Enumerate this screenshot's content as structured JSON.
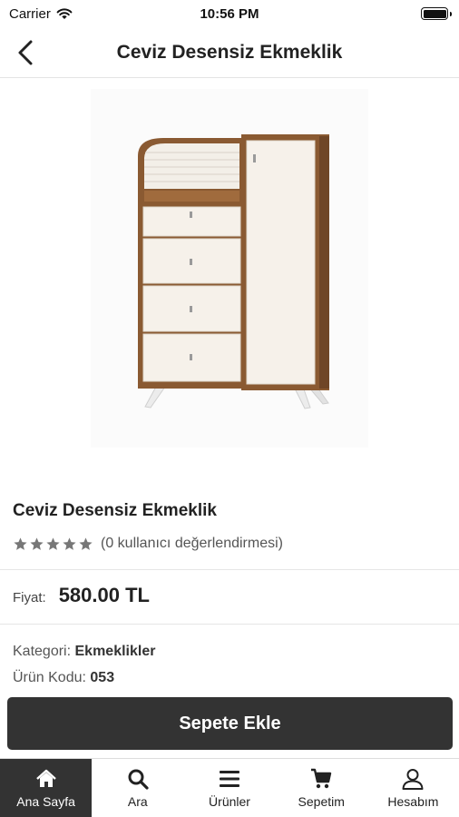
{
  "status": {
    "carrier": "Carrier",
    "time": "10:56 PM"
  },
  "nav": {
    "title": "Ceviz Desensiz Ekmeklik"
  },
  "product": {
    "name": "Ceviz Desensiz Ekmeklik",
    "rating_text": "(0 kullanıcı değerlendirmesi)",
    "rating_value": 0,
    "rating_max": 5,
    "price_label": "Fiyat:",
    "price": "580.00 TL",
    "category_label": "Kategori:",
    "category": "Ekmeklikler",
    "code_label": "Ürün Kodu:",
    "code": "053"
  },
  "actions": {
    "add_to_cart": "Sepete Ekle"
  },
  "tabs": [
    {
      "label": "Ana Sayfa",
      "icon": "home-icon",
      "active": true
    },
    {
      "label": "Ara",
      "icon": "search-icon",
      "active": false
    },
    {
      "label": "Ürünler",
      "icon": "menu-icon",
      "active": false
    },
    {
      "label": "Sepetim",
      "icon": "cart-icon",
      "active": false
    },
    {
      "label": "Hesabım",
      "icon": "user-icon",
      "active": false
    }
  ],
  "colors": {
    "accent": "#333333",
    "star": "#777777",
    "wood": "#8a5a32",
    "panel": "#f6f1ea"
  }
}
